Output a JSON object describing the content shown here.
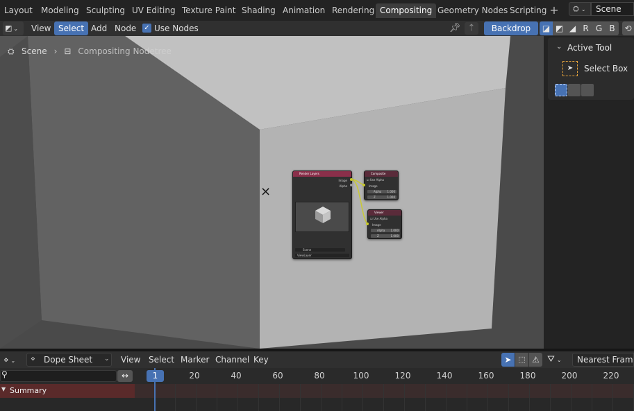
{
  "workspaces": {
    "tabs": [
      "Layout",
      "Modeling",
      "Sculpting",
      "UV Editing",
      "Texture Paint",
      "Shading",
      "Animation",
      "Rendering",
      "Compositing",
      "Geometry Nodes",
      "Scripting"
    ],
    "active": "Compositing",
    "add_label": "+",
    "scene_icon": "scene-icon",
    "scene_name": "Scene"
  },
  "node_editor": {
    "menus": [
      "View",
      "Select",
      "Add",
      "Node"
    ],
    "active_menu": "Select",
    "use_nodes_label": "Use Nodes",
    "use_nodes_checked": true,
    "backdrop_label": "Backdrop",
    "channels": [
      "RGB",
      "RGB+A",
      "A",
      "R",
      "G",
      "B"
    ],
    "channel_labels": {
      "r": "R",
      "g": "G",
      "b": "B"
    },
    "breadcrumb": {
      "scene": "Scene",
      "tree": "Compositing Nodetree"
    }
  },
  "nodes": {
    "render_layers": {
      "title": "Render Layers",
      "outputs": [
        "Image",
        "Alpha"
      ],
      "scene": "Scene",
      "layer": "ViewLayer"
    },
    "composite": {
      "title": "Composite",
      "use_alpha": "Use Alpha",
      "inputs": [
        "Image"
      ],
      "alpha_label": "Alpha",
      "alpha_value": "1.000",
      "z_label": "Z",
      "z_value": "1.000"
    },
    "viewer": {
      "title": "Viewer",
      "use_alpha": "Use Alpha",
      "inputs": [
        "Image"
      ],
      "alpha_label": "Alpha",
      "alpha_value": "1.000",
      "z_label": "Z",
      "z_value": "1.000"
    }
  },
  "sidebar": {
    "panel_title": "Active Tool",
    "tool_label": "Select Box"
  },
  "dope_sheet": {
    "editor_type_icon": "dope-sheet-icon",
    "mode": "Dope Sheet",
    "menus": [
      "View",
      "Select",
      "Marker",
      "Channel",
      "Key"
    ],
    "snap": "Nearest Frame",
    "summary_label": "Summary",
    "current_frame": "1",
    "ticks": [
      "20",
      "40",
      "60",
      "80",
      "100",
      "120",
      "140",
      "160",
      "180",
      "200",
      "220"
    ]
  },
  "colors": {
    "accent": "#4772b3",
    "render_layers_header": "#8a2f4a",
    "output_header": "#5a2b3a",
    "link": "#c8c83a",
    "summary_row": "#5a2a2a",
    "tool_outline": "#e4a23b"
  }
}
